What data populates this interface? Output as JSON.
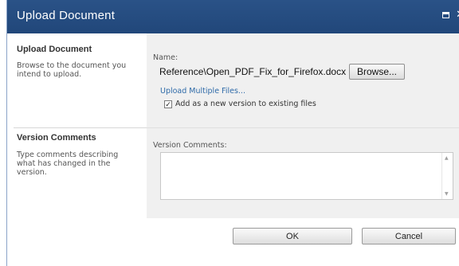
{
  "dialog": {
    "title": "Upload Document",
    "icons": [
      "maximize-icon",
      "close-icon"
    ]
  },
  "upload_section": {
    "title": "Upload Document",
    "description": "Browse to the document you intend to upload.",
    "name_label": "Name:",
    "file_path_value": "Reference\\Open_PDF_Fix_for_Firefox.docx",
    "browse_label": "Browse...",
    "upload_multiple_label": "Upload Multiple Files...",
    "add_version_checked": true,
    "add_version_label": "Add as a new version to existing files"
  },
  "version_section": {
    "title": "Version Comments",
    "description": "Type comments describing what has changed in the version.",
    "comments_label": "Version Comments:",
    "comments_value": ""
  },
  "buttons": {
    "ok": "OK",
    "cancel": "Cancel"
  },
  "colors": {
    "titlebar": "#23497c",
    "link": "#2e6aa8",
    "panel_bg": "#f0f0f0"
  }
}
